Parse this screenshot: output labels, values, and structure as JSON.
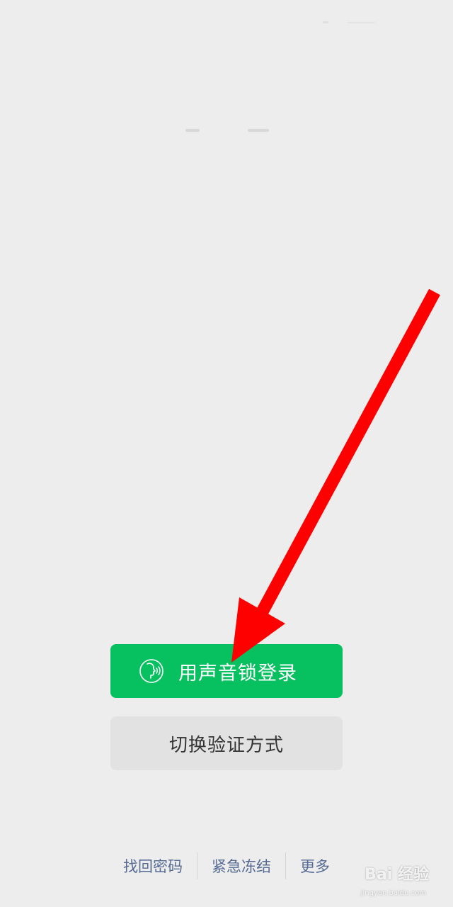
{
  "login": {
    "voice_button_label": "用声音锁登录",
    "switch_button_label": "切换验证方式"
  },
  "footer": {
    "links": [
      "找回密码",
      "紧急冻结",
      "更多"
    ]
  },
  "icons": {
    "voice": "voice-lock-icon"
  },
  "colors": {
    "background": "#ededed",
    "primary_green": "#07c160",
    "secondary_button": "#e2e2e2",
    "link_blue": "#576b95",
    "annotation_arrow": "#ff0000"
  },
  "watermark": {
    "brand": "Bai 经验",
    "url": "jingyan.baidu.com"
  }
}
